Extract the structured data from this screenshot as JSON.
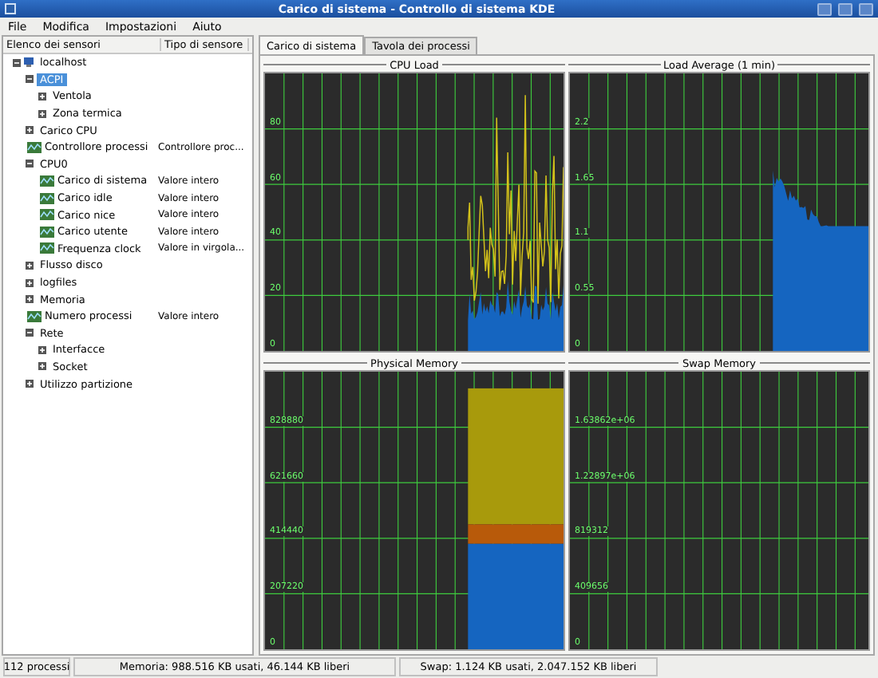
{
  "window": {
    "title": "Carico di sistema - Controllo di sistema KDE"
  },
  "menu": [
    "File",
    "Modifica",
    "Impostazioni",
    "Aiuto"
  ],
  "sensor_browser": {
    "columns": [
      "Elenco dei sensori",
      "Tipo di sensore"
    ],
    "tree": [
      {
        "kind": "host",
        "label": "localhost",
        "expanded": true,
        "selected": false,
        "children": [
          {
            "kind": "folder",
            "label": "ACPI",
            "expanded": true,
            "selected": true,
            "children": [
              {
                "kind": "folder",
                "label": "Ventola",
                "expanded": false,
                "selected": false
              },
              {
                "kind": "folder",
                "label": "Zona termica",
                "expanded": false,
                "selected": false
              }
            ]
          },
          {
            "kind": "folder",
            "label": "Carico CPU",
            "expanded": false,
            "selected": false
          },
          {
            "kind": "sensor",
            "label": "Controllore processi",
            "type": "Controllore proc...",
            "selected": false
          },
          {
            "kind": "folder",
            "label": "CPU0",
            "expanded": true,
            "selected": false,
            "children": [
              {
                "kind": "sensor",
                "label": "Carico di sistema",
                "type": "Valore intero",
                "selected": false
              },
              {
                "kind": "sensor",
                "label": "Carico idle",
                "type": "Valore intero",
                "selected": false
              },
              {
                "kind": "sensor",
                "label": "Carico nice",
                "type": "Valore intero",
                "selected": false
              },
              {
                "kind": "sensor",
                "label": "Carico utente",
                "type": "Valore intero",
                "selected": false
              },
              {
                "kind": "sensor",
                "label": "Frequenza clock",
                "type": "Valore in virgola...",
                "selected": false
              }
            ]
          },
          {
            "kind": "folder",
            "label": "Flusso disco",
            "expanded": false,
            "selected": false
          },
          {
            "kind": "folder",
            "label": "logfiles",
            "expanded": false,
            "selected": false
          },
          {
            "kind": "folder",
            "label": "Memoria",
            "expanded": false,
            "selected": false
          },
          {
            "kind": "sensor",
            "label": "Numero processi",
            "type": "Valore intero",
            "selected": false
          },
          {
            "kind": "folder",
            "label": "Rete",
            "expanded": true,
            "selected": false,
            "children": [
              {
                "kind": "folder",
                "label": "Interfacce",
                "expanded": false,
                "selected": false
              },
              {
                "kind": "folder",
                "label": "Socket",
                "expanded": false,
                "selected": false
              }
            ]
          },
          {
            "kind": "folder",
            "label": "Utilizzo partizione",
            "expanded": false,
            "selected": false
          }
        ]
      }
    ]
  },
  "tabs": [
    {
      "label": "Carico di sistema",
      "selected": true
    },
    {
      "label": "Tavola dei processi",
      "selected": false
    }
  ],
  "plotters": [
    {
      "title": "CPU Load",
      "kind": "cpu",
      "ticks": [
        "80",
        "60",
        "40",
        "20",
        "0"
      ]
    },
    {
      "title": "Load Average (1 min)",
      "kind": "load",
      "ticks": [
        "2.2",
        "1.65",
        "1.1",
        "0.55",
        "0"
      ]
    },
    {
      "title": "Physical Memory",
      "kind": "memory",
      "ticks": [
        "828880",
        "621660",
        "414440",
        "207220",
        "0"
      ]
    },
    {
      "title": "Swap Memory",
      "kind": "swap",
      "ticks": [
        "1.63862e+06",
        "1.22897e+06",
        "819312",
        "409656",
        "0"
      ]
    }
  ],
  "status_bar": [
    "112 processi",
    "Memoria: 988.516 KB usati, 46.144 KB liberi",
    "Swap: 1.124 KB usati, 2.047.152 KB liberi"
  ]
}
